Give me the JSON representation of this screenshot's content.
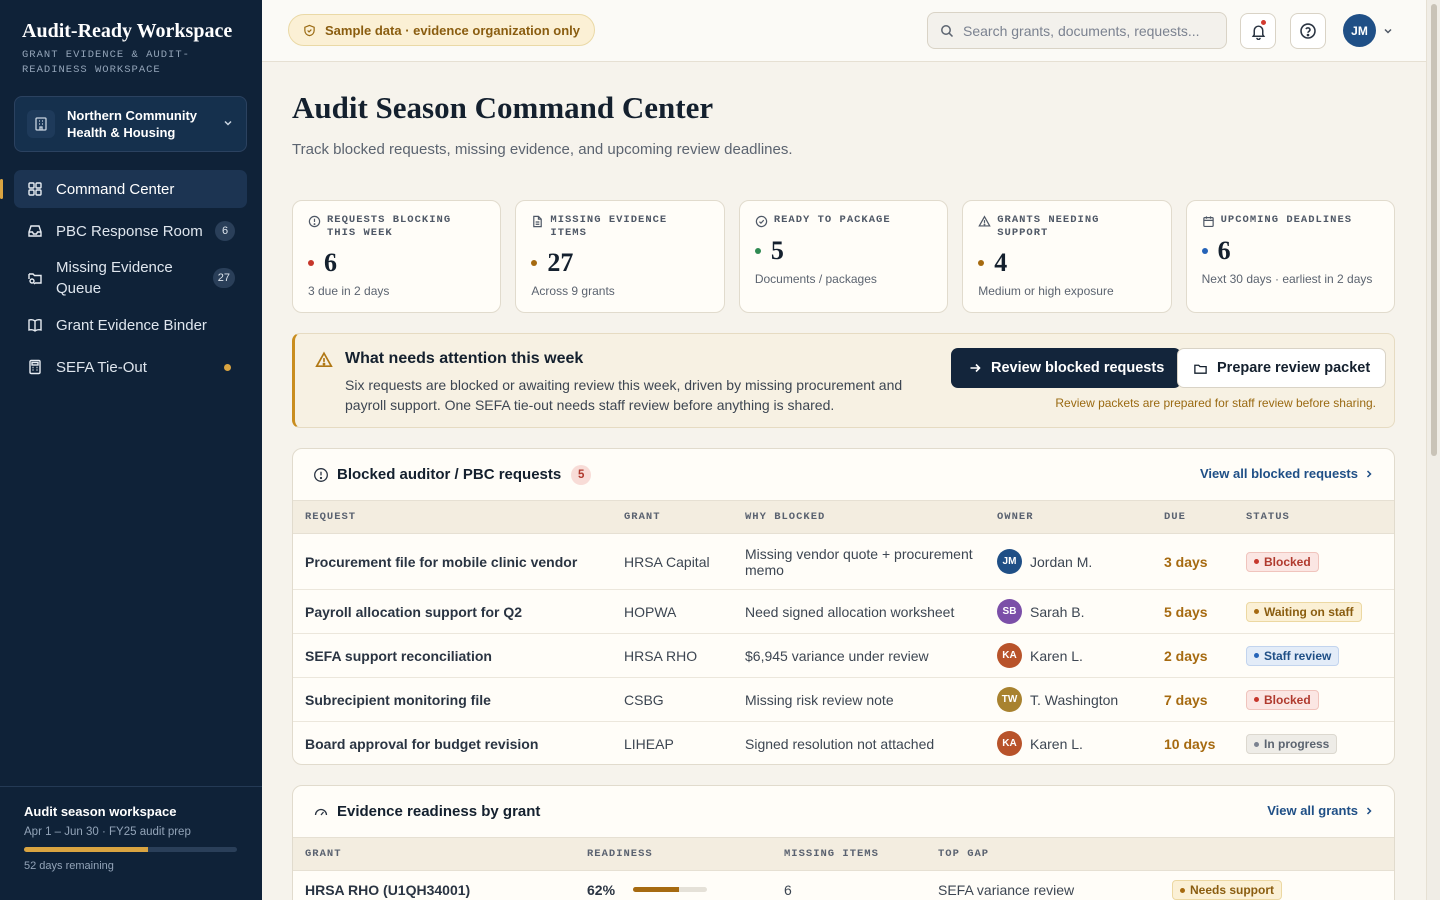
{
  "sidebar": {
    "brand_title": "Audit-Ready Workspace",
    "brand_subtitle": "Grant evidence & audit-readiness workspace",
    "org_name": "Northern Community Health & Housing",
    "nav": [
      {
        "label": "Command Center",
        "count": "",
        "icon": "dashboard-icon"
      },
      {
        "label": "PBC Response Room",
        "count": "6",
        "icon": "inbox-icon"
      },
      {
        "label": "Missing Evidence Queue",
        "count": "27",
        "icon": "folder-search-icon"
      },
      {
        "label": "Grant Evidence Binder",
        "count": "",
        "icon": "book-icon"
      },
      {
        "label": "SEFA Tie-Out",
        "count": "",
        "icon": "calculator-icon"
      }
    ],
    "season": {
      "title": "Audit season workspace",
      "dates": "Apr 1 – Jun 30 · FY25 audit prep",
      "progress": 0.58,
      "remaining": "52 days remaining"
    }
  },
  "topbar": {
    "sample_label": "Sample data · evidence organization only",
    "search_placeholder": "Search grants, documents, requests...",
    "user_initials": "JM"
  },
  "page": {
    "title": "Audit Season Command Center",
    "subtitle": "Track blocked requests, missing evidence, and upcoming review deadlines."
  },
  "kpis": [
    {
      "label": "Requests blocking this week",
      "value": "6",
      "note": "3 due in 2 days",
      "color": "#c6362b",
      "icon": "alert-circle-icon"
    },
    {
      "label": "Missing evidence items",
      "value": "27",
      "note": "Across 9 grants",
      "color": "#a66a10",
      "icon": "document-icon"
    },
    {
      "label": "Ready to package",
      "value": "5",
      "note": "Documents / packages",
      "color": "#2f8a52",
      "icon": "check-circle-icon"
    },
    {
      "label": "Grants needing support",
      "value": "4",
      "note": "Medium or high exposure",
      "color": "#a66a10",
      "icon": "warning-icon"
    },
    {
      "label": "Upcoming deadlines",
      "value": "6",
      "note": "Next 30 days · earliest in 2 days",
      "color": "#2563b8",
      "icon": "calendar-icon"
    }
  ],
  "attention": {
    "title": "What needs attention this week",
    "body": "Six requests are blocked or awaiting review this week, driven by missing procurement and payroll support. One SEFA tie-out needs staff review before anything is shared.",
    "primary_label": "Review blocked requests",
    "secondary_label": "Prepare review packet",
    "note": "Review packets are prepared for staff review before sharing."
  },
  "blocked": {
    "title": "Blocked auditor / PBC requests",
    "count": "5",
    "link": "View all blocked requests",
    "columns": [
      "Request",
      "Grant",
      "Why blocked",
      "Owner",
      "Due",
      "Status"
    ],
    "rows": [
      {
        "request": "Procurement file for mobile clinic vendor",
        "grant": "HRSA Capital",
        "why": "Missing vendor quote + procurement memo",
        "initials": "JM",
        "owner": "Jordan M.",
        "owner_color": "#1f4f86",
        "due": "3 days",
        "status": "Blocked",
        "status_kind": "blocked"
      },
      {
        "request": "Payroll allocation support for Q2",
        "grant": "HOPWA",
        "why": "Need signed allocation worksheet",
        "initials": "SB",
        "owner": "Sarah B.",
        "owner_color": "#7b4fa8",
        "due": "5 days",
        "status": "Waiting on staff",
        "status_kind": "waiting"
      },
      {
        "request": "SEFA support reconciliation",
        "grant": "HRSA RHO",
        "why": "$6,945 variance under review",
        "initials": "KA",
        "owner": "Karen L.",
        "owner_color": "#b8532a",
        "due": "2 days",
        "status": "Staff review",
        "status_kind": "review"
      },
      {
        "request": "Subrecipient monitoring file",
        "grant": "CSBG",
        "why": "Missing risk review note",
        "initials": "TW",
        "owner": "T. Washington",
        "owner_color": "#a8822f",
        "due": "7 days",
        "status": "Blocked",
        "status_kind": "blocked"
      },
      {
        "request": "Board approval for budget revision",
        "grant": "LIHEAP",
        "why": "Signed resolution not attached",
        "initials": "KA",
        "owner": "Karen L.",
        "owner_color": "#b8532a",
        "due": "10 days",
        "status": "In progress",
        "status_kind": "progress"
      }
    ]
  },
  "readiness": {
    "title": "Evidence readiness by grant",
    "link": "View all grants",
    "columns": [
      "Grant",
      "Readiness",
      "Missing items",
      "Top gap",
      ""
    ],
    "rows": [
      {
        "grant": "HRSA RHO (U1QH34001)",
        "readiness": "62%",
        "readiness_value": 0.62,
        "missing": "6",
        "gap": "SEFA variance review",
        "status": "Needs support"
      }
    ]
  },
  "colors": {
    "accent": "#d9a441",
    "navy": "#0f2238",
    "primary_button": "#13253b"
  }
}
